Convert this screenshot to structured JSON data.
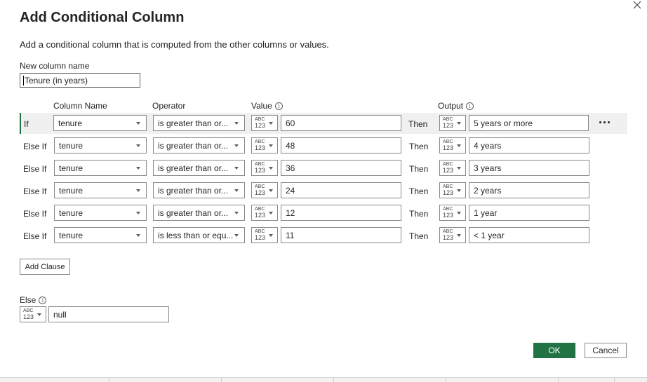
{
  "dialog": {
    "title": "Add Conditional Column",
    "subtitle": "Add a conditional column that is computed from the other columns or values.",
    "close_icon": "close-icon"
  },
  "new_column": {
    "label": "New column name",
    "value": "Tenure (in years)"
  },
  "headers": {
    "column_name": "Column Name",
    "operator": "Operator",
    "value": "Value",
    "output": "Output",
    "info_glyph": "i"
  },
  "type_selector": {
    "abc": "ABC",
    "num": "123"
  },
  "clauses": [
    {
      "keyword": "If",
      "column": "tenure",
      "operator": "is greater than or...",
      "value": "60",
      "then": "Then",
      "output": "5 years or more"
    },
    {
      "keyword": "Else If",
      "column": "tenure",
      "operator": "is greater than or...",
      "value": "48",
      "then": "Then",
      "output": "4 years"
    },
    {
      "keyword": "Else If",
      "column": "tenure",
      "operator": "is greater than or...",
      "value": "36",
      "then": "Then",
      "output": "3 years"
    },
    {
      "keyword": "Else If",
      "column": "tenure",
      "operator": "is greater than or...",
      "value": "24",
      "then": "Then",
      "output": "2 years"
    },
    {
      "keyword": "Else If",
      "column": "tenure",
      "operator": "is greater than or...",
      "value": "12",
      "then": "Then",
      "output": "1 year"
    },
    {
      "keyword": "Else If",
      "column": "tenure",
      "operator": "is less than or equ...",
      "value": "11",
      "then": "Then",
      "output": "< 1 year"
    }
  ],
  "buttons": {
    "add_clause": "Add Clause",
    "ok": "OK",
    "cancel": "Cancel"
  },
  "else": {
    "label": "Else",
    "value": "null"
  },
  "colors": {
    "accent": "#217346",
    "active_row_bg": "#f0f0f0",
    "text": "#252423",
    "border": "#8a8886"
  }
}
